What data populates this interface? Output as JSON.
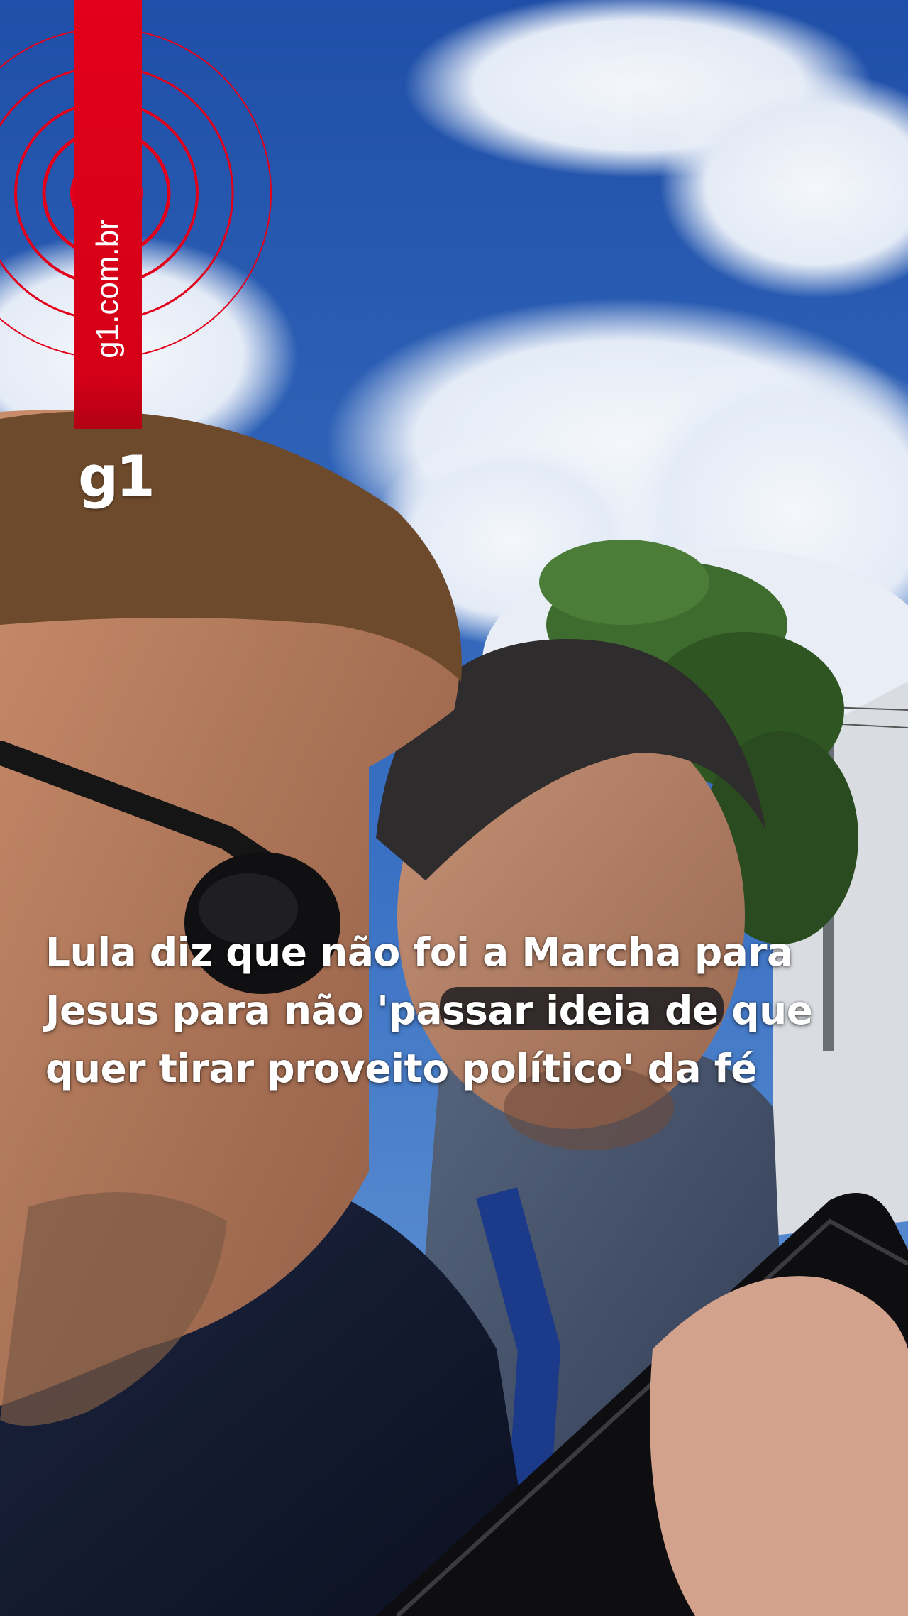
{
  "brand": {
    "url_label": "g1.com.br",
    "logo_text": "g1",
    "accent_color": "#e2001a"
  },
  "caption": {
    "line1": "Lula diz que não foi a Marcha para",
    "line2": "Jesus para não 'passar ideia de que",
    "line3": "quer tirar proveito político' da fé"
  }
}
